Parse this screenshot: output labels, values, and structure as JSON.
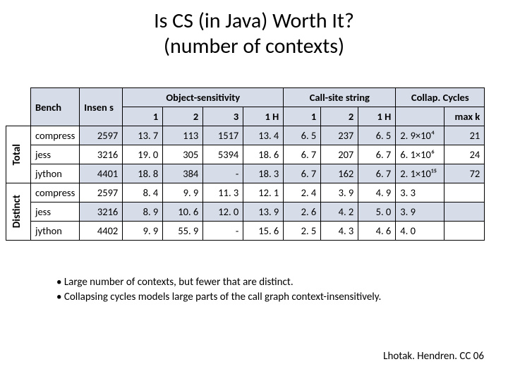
{
  "title_line1": "Is CS (in Java) Worth It?",
  "title_line2": "(number of contexts)",
  "headers": {
    "bench": "Bench",
    "insens": "Insen s",
    "objsens": "Object-sensitivity",
    "callsite": "Call-site string",
    "collap": "Collap. Cycles",
    "c1": "1",
    "c2": "2",
    "c3": "3",
    "c1H_a": "1 H",
    "cs1": "1",
    "cs2": "2",
    "cs1H": "1 H",
    "maxk": "max k"
  },
  "groups": {
    "total": "Total",
    "distinct": "Distinct"
  },
  "rowsTotal": [
    {
      "bench": "compress",
      "insens": "2597",
      "o1": "13. 7",
      "o2": "113",
      "o3": "1517",
      "o1h": "13. 4",
      "c1": "6. 5",
      "c2": "237",
      "c1h": "6. 5",
      "col": "2. 9×10⁴",
      "maxk": "21"
    },
    {
      "bench": "jess",
      "insens": "3216",
      "o1": "19. 0",
      "o2": "305",
      "o3": "5394",
      "o1h": "18. 6",
      "c1": "6. 7",
      "c2": "207",
      "c1h": "6. 7",
      "col": "6. 1×10⁶",
      "maxk": "24"
    },
    {
      "bench": "jython",
      "insens": "4401",
      "o1": "18. 8",
      "o2": "384",
      "o3": "-",
      "o1h": "18. 3",
      "c1": "6. 7",
      "c2": "162",
      "c1h": "6. 7",
      "col": "2. 1×10¹⁵",
      "maxk": "72"
    }
  ],
  "rowsDistinct": [
    {
      "bench": "compress",
      "insens": "2597",
      "o1": "8. 4",
      "o2": "9. 9",
      "o3": "11. 3",
      "o1h": "12. 1",
      "c1": "2. 4",
      "c2": "3. 9",
      "c1h": "4. 9",
      "col": "3. 3",
      "maxk": ""
    },
    {
      "bench": "jess",
      "insens": "3216",
      "o1": "8. 9",
      "o2": "10. 6",
      "o3": "12. 0",
      "o1h": "13. 9",
      "c1": "2. 6",
      "c2": "4. 2",
      "c1h": "5. 0",
      "col": "3. 9",
      "maxk": ""
    },
    {
      "bench": "jython",
      "insens": "4402",
      "o1": "9. 9",
      "o2": "55. 9",
      "o3": "-",
      "o1h": "15. 6",
      "c1": "2. 5",
      "c2": "4. 3",
      "c1h": "4. 6",
      "col": "4. 0",
      "maxk": ""
    }
  ],
  "bullets": {
    "b1": "Large number of contexts, but fewer that are distinct.",
    "b2": "Collapsing cycles models large parts of the call graph context-insensitively."
  },
  "footer": "Lhotak. Hendren. CC 06",
  "chart_data": {
    "type": "table",
    "title": "Is CS (in Java) Worth It? (number of contexts)",
    "column_groups": [
      "Bench",
      "Insens",
      "Object-sensitivity 1",
      "Object-sensitivity 2",
      "Object-sensitivity 3",
      "Object-sensitivity 1H",
      "Call-site string 1",
      "Call-site string 2",
      "Call-site string 1H",
      "Collap. Cycles",
      "max k"
    ],
    "sections": [
      {
        "name": "Total",
        "rows": [
          [
            "compress",
            2597,
            13.7,
            113,
            1517,
            13.4,
            6.5,
            237,
            6.5,
            "2.9×10^4",
            21
          ],
          [
            "jess",
            3216,
            19.0,
            305,
            5394,
            18.6,
            6.7,
            207,
            6.7,
            "6.1×10^6",
            24
          ],
          [
            "jython",
            4401,
            18.8,
            384,
            null,
            18.3,
            6.7,
            162,
            6.7,
            "2.1×10^15",
            72
          ]
        ]
      },
      {
        "name": "Distinct",
        "rows": [
          [
            "compress",
            2597,
            8.4,
            9.9,
            11.3,
            12.1,
            2.4,
            3.9,
            4.9,
            3.3,
            null
          ],
          [
            "jess",
            3216,
            8.9,
            10.6,
            12.0,
            13.9,
            2.6,
            4.2,
            5.0,
            3.9,
            null
          ],
          [
            "jython",
            4402,
            9.9,
            55.9,
            null,
            15.6,
            2.5,
            4.3,
            4.6,
            4.0,
            null
          ]
        ]
      }
    ]
  }
}
